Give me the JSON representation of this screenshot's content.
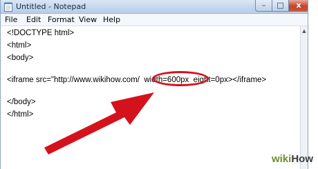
{
  "window": {
    "title": "Untitled - Notepad",
    "buttons": {
      "minimize": "–",
      "maximize": "□",
      "close": "x"
    }
  },
  "menu": [
    "File",
    "Edit",
    "Format",
    "View",
    "Help"
  ],
  "editor": {
    "lines": [
      "<!DOCTYPE html>",
      "<html>",
      "<body>",
      "",
      "<iframe src=\"http://www.wikihow.com/  width=600px  eight=0px></iframe>",
      "",
      "</body>",
      "</html>"
    ]
  },
  "annotation": {
    "highlighted_text": "width=600px",
    "color": "#d4121b"
  },
  "watermark": {
    "part1": "wiki",
    "part2": "How"
  }
}
